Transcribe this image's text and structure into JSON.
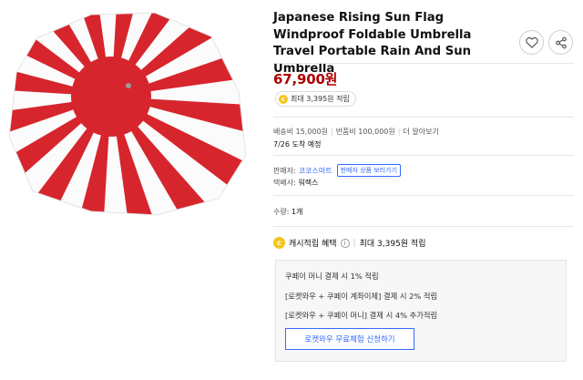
{
  "product": {
    "image_alt_icon": "rising-sun-umbrella-image",
    "title": "Japanese Rising Sun Flag Windproof Foldable Umbrella Travel Portable Rain And Sun Umbrella",
    "price": "67,900원",
    "reward_pill": "최대 3,395원 적립"
  },
  "icons": {
    "favorite": "heart-icon",
    "share": "share-icon"
  },
  "shipping": {
    "fee": "배송비 15,000원",
    "return_fee": "반품비 100,000원",
    "more": "더 알아보기",
    "arrival": "7/26 도착 예정"
  },
  "seller": {
    "label": "판매자:",
    "name": "코코스마트",
    "view_products_button": "판매자 상품 보러가기",
    "courier_label": "택배사:",
    "courier_name": "워렉스"
  },
  "quantity": {
    "label": "수량:",
    "value": "1개"
  },
  "cash_reward": {
    "label": "캐시적립 혜택",
    "max": "최대 3,395원 적립"
  },
  "benefits": {
    "lines": [
      "쿠페이 머니 결제 시 1% 적립",
      "[로켓와우 + 쿠페이 계좌이체] 결제 시 2% 적립",
      "[로켓와우 + 쿠페이 머니] 결제 시 4% 추가적립"
    ],
    "trial_button": "로켓와우 무료체험 신청하기"
  },
  "colors": {
    "price_red": "#ae0000",
    "accent_blue": "#346aff",
    "coin_yellow": "#f5c518",
    "flag_red": "#d7252d"
  }
}
